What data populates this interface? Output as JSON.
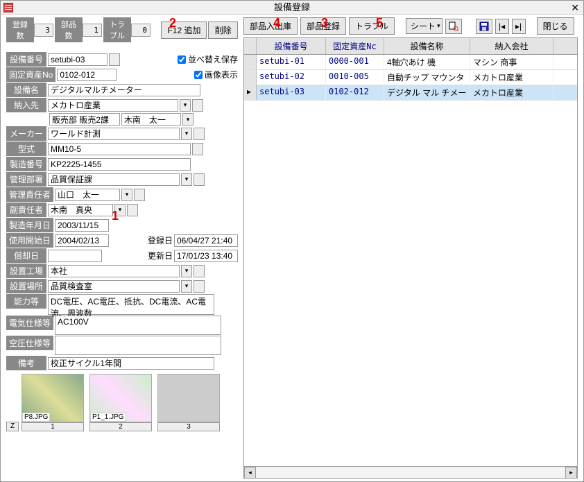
{
  "title": "設備登録",
  "annotations": {
    "n1": "1",
    "n2": "2",
    "n3": "3",
    "n4": "4",
    "n5": "5"
  },
  "stats": {
    "reg_lbl": "登録数",
    "reg_val": "3",
    "parts_lbl": "部品数",
    "parts_val": "1",
    "trouble_lbl": "トラブル",
    "trouble_val": "0"
  },
  "buttons": {
    "f12add": "F12 追加",
    "del": "削除",
    "partsInOut": "部品入出庫",
    "partsReg": "部品登録",
    "trouble": "トラブル",
    "sheet": "シート",
    "close": "閉じる"
  },
  "checks": {
    "reorder": "並べ替え保存",
    "image": "画像表示"
  },
  "labels": {
    "equipNo": "設備番号",
    "assetNo": "固定資産No",
    "equipName": "設備名",
    "supplier": "納入先",
    "maker": "メーカー",
    "model": "型式",
    "serial": "製造番号",
    "dept": "管理部署",
    "mgr": "管理責任者",
    "sub": "副責任者",
    "mfgDate": "製造年月日",
    "startDate": "使用開始日",
    "regDate": "登録日",
    "retireDate": "償却日",
    "updDate": "更新日",
    "factory": "設置工場",
    "location": "設置場所",
    "capability": "能力等",
    "elec": "電気仕様等",
    "air": "空圧仕様等",
    "note": "備考"
  },
  "values": {
    "equipNo": "setubi-03",
    "assetNo": "0102-012",
    "equipName": "デジタルマルチメーター",
    "supplier": "メカトロ産業",
    "supplierDept": "販売部 販売2課",
    "supplierPerson": "木南　太一",
    "maker": "ワールド計測",
    "model": "MM10-5",
    "serial": "KP2225-1455",
    "dept": "品質保証課",
    "mgr": "山口　太一",
    "sub": "木南　真央",
    "mfgDate": "2003/11/15",
    "startDate": "2004/02/13",
    "regDate": "06/04/27 21:40",
    "retireDate": "",
    "updDate": "17/01/23 13:40",
    "factory": "本社",
    "location": "品質検査室",
    "capability": "DC電圧、AC電圧、抵抗、DC電流、AC電流、周波数",
    "elec": "AC100V",
    "air": "",
    "note": "校正サイクル1年間"
  },
  "grid": {
    "headers": {
      "c1": "設備番号",
      "c2": "固定資産Nc",
      "c3": "設備名称",
      "c4": "納入会社"
    },
    "rows": [
      {
        "id": "setubi-01",
        "asset": "0000-001",
        "name": "4軸穴あけ 機",
        "co": "マシン 商事"
      },
      {
        "id": "setubi-02",
        "asset": "0010-005",
        "name": "自動チップ マウンタ",
        "co": "メカトロ産業"
      },
      {
        "id": "setubi-03",
        "asset": "0102-012",
        "name": "デジタル マル チメー",
        "co": "メカトロ産業",
        "sel": true
      }
    ]
  },
  "thumbs": [
    {
      "name": "P8.JPG",
      "num": "1",
      "cls": "flowers1"
    },
    {
      "name": "P1_1.JPG",
      "num": "2",
      "cls": "flowers2"
    },
    {
      "name": "",
      "num": "3",
      "cls": ""
    }
  ],
  "z": "Z"
}
